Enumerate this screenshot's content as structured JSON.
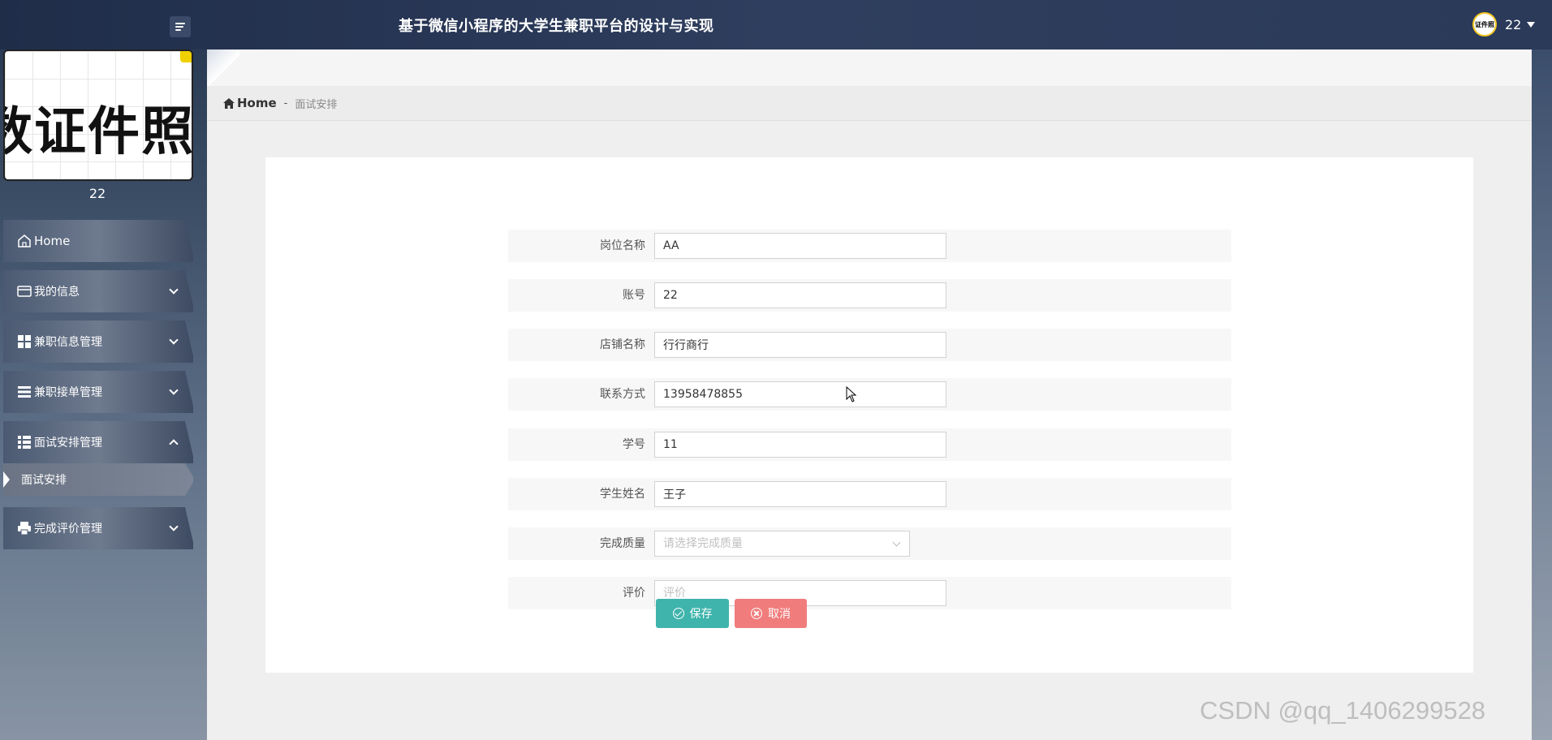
{
  "header": {
    "title": "基于微信小程序的大学生兼职平台的设计与实现",
    "user_name": "22",
    "avatar_text": "证件照"
  },
  "sidebar": {
    "profile_image_text": "数证件照",
    "profile_name": "22",
    "items": [
      {
        "label": "Home",
        "icon": "home-icon"
      },
      {
        "label": "我的信息",
        "icon": "card-icon"
      },
      {
        "label": "兼职信息管理",
        "icon": "grid-icon"
      },
      {
        "label": "兼职接单管理",
        "icon": "list-icon"
      },
      {
        "label": "面试安排管理",
        "icon": "table-icon",
        "expanded": true
      },
      {
        "label": "完成评价管理",
        "icon": "printer-icon"
      }
    ],
    "subitems": [
      {
        "label": "面试安排",
        "active": true
      }
    ]
  },
  "breadcrumb": {
    "home": "Home",
    "separator": "-",
    "current": "面试安排"
  },
  "form": {
    "fields": [
      {
        "label": "岗位名称",
        "value": "AA"
      },
      {
        "label": "账号",
        "value": "22"
      },
      {
        "label": "店铺名称",
        "value": "行行商行"
      },
      {
        "label": "联系方式",
        "value": "13958478855"
      },
      {
        "label": "学号",
        "value": "11"
      },
      {
        "label": "学生姓名",
        "value": "王子"
      },
      {
        "label": "完成质量",
        "value": "",
        "placeholder": "请选择完成质量"
      },
      {
        "label": "评价",
        "value": "",
        "placeholder": "评价"
      }
    ],
    "save_label": "保存",
    "cancel_label": "取消"
  },
  "watermark": "CSDN @qq_1406299528",
  "colors": {
    "save": "#3fb4ac",
    "cancel": "#f17c7c",
    "header": "#2b3a59"
  }
}
